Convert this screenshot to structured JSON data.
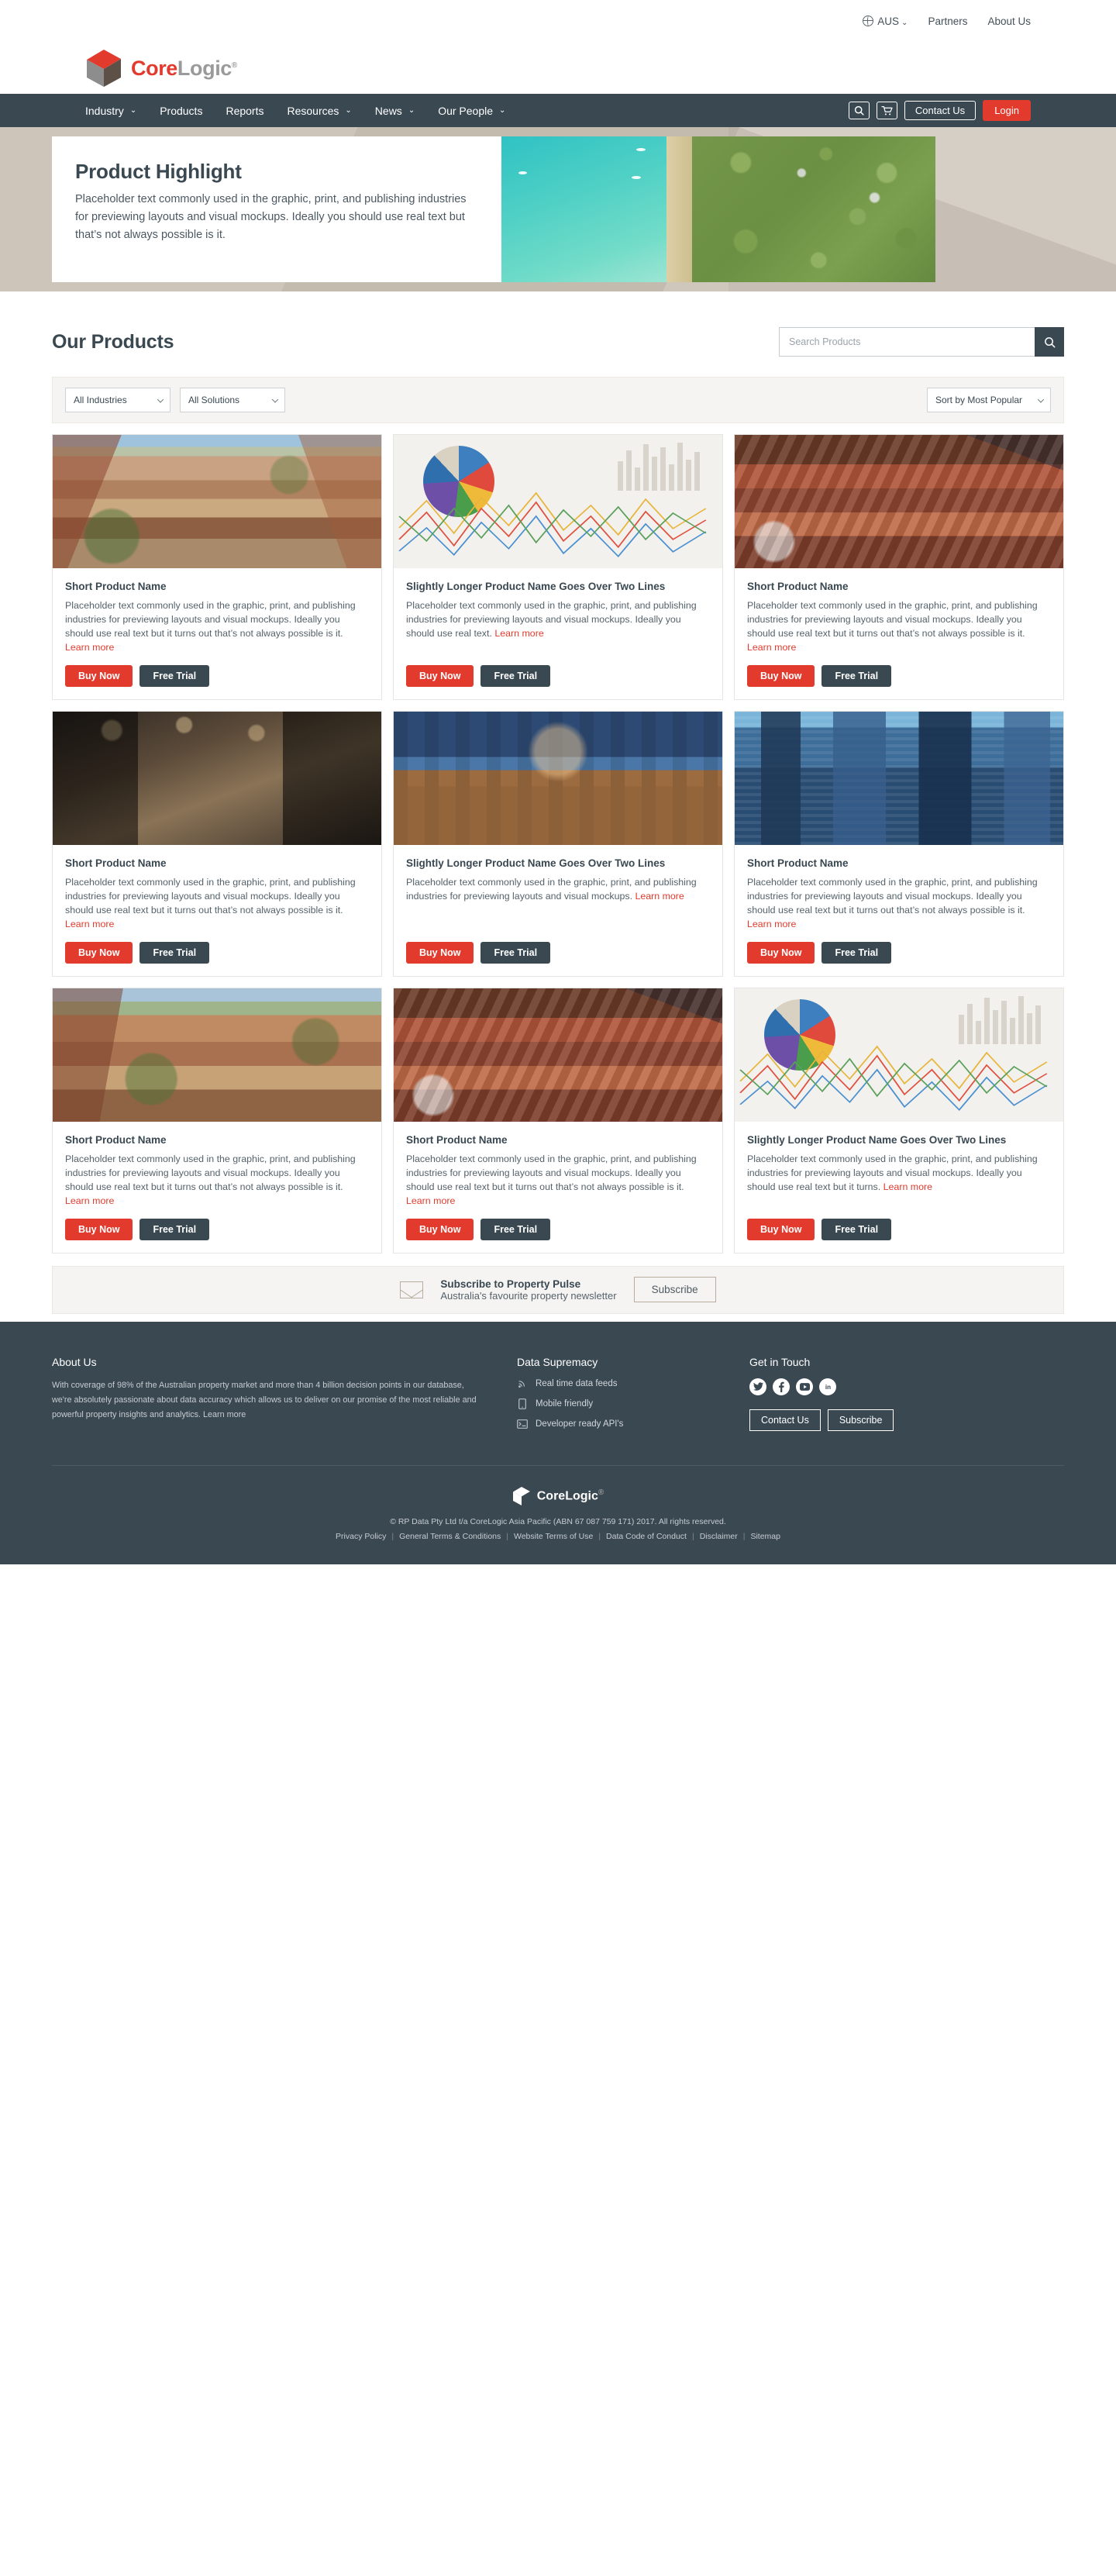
{
  "brand": {
    "core": "Core",
    "logic": "Logic",
    "reg": "®",
    "accent_red": "#e23b2e",
    "dark": "#3a4852"
  },
  "utility": {
    "region_label": "AUS",
    "region_icon": "globe-icon",
    "links": [
      "Partners",
      "About Us"
    ]
  },
  "nav": {
    "items": [
      {
        "label": "Industry",
        "has_dropdown": true
      },
      {
        "label": "Products",
        "has_dropdown": false
      },
      {
        "label": "Reports",
        "has_dropdown": false
      },
      {
        "label": "Resources",
        "has_dropdown": true
      },
      {
        "label": "News",
        "has_dropdown": true
      },
      {
        "label": "Our People",
        "has_dropdown": true
      }
    ],
    "search_icon": "search-icon",
    "cart_icon": "shopping-cart-icon",
    "contact_label": "Contact Us",
    "login_label": "Login"
  },
  "hero": {
    "title": "Product Highlight",
    "text": "Placeholder text commonly used in the graphic, print, and publishing industries for previewing layouts and visual mockups. Ideally you should use real text but that’s not always possible is it.",
    "image_alt": "aerial-coastline-photo"
  },
  "products_section": {
    "title": "Our Products",
    "search_placeholder": "Search Products",
    "search_value": "",
    "search_button_icon": "search-icon",
    "filters": [
      {
        "name": "industry-filter",
        "value": "All Industries"
      },
      {
        "name": "solutions-filter",
        "value": "All Solutions"
      }
    ],
    "sort": {
      "name": "sort-filter",
      "value": "Sort by Most Popular"
    },
    "buy_label": "Buy Now",
    "trial_label": "Free Trial",
    "learn_more_label": "Learn more",
    "cards": [
      {
        "name": "Short Product Name",
        "desc": "Placeholder text commonly used in the graphic, print, and publishing industries for previewing layouts and visual mockups. Ideally you should use real text but it turns out that’s not always possible is it. ",
        "art": "art-suburb1"
      },
      {
        "name": "Slightly Longer Product Name Goes Over Two Lines",
        "desc": "Placeholder text commonly used in the graphic, print, and publishing industries for previewing layouts and visual mockups. Ideally you should use real text. ",
        "art": "art-chart"
      },
      {
        "name": "Short Product Name",
        "desc": "Placeholder text commonly used in the graphic, print, and publishing industries for previewing layouts and visual mockups. Ideally you should use real text but it turns out that’s not always possible is it. ",
        "art": "art-roofs"
      },
      {
        "name": "Short Product Name",
        "desc": "Placeholder text commonly used in the graphic, print, and publishing industries for previewing layouts and visual mockups. Ideally you should use real text but it turns out that’s not always possible is it. ",
        "art": "art-lobby"
      },
      {
        "name": "Slightly Longer Product Name Goes Over Two Lines",
        "desc": "Placeholder text commonly used in the graphic, print, and publishing industries for previewing layouts and visual mockups. ",
        "art": "art-terrace"
      },
      {
        "name": "Short Product Name",
        "desc": "Placeholder text commonly used in the graphic, print, and publishing industries for previewing layouts and visual mockups. Ideally you should use real text but it turns out that’s not always possible is it. ",
        "art": "art-city"
      },
      {
        "name": "Short Product Name",
        "desc": "Placeholder text commonly used in the graphic, print, and publishing industries for previewing layouts and visual mockups. Ideally you should use real text but it turns out that’s not always possible is it. ",
        "art": "art-aerial"
      },
      {
        "name": "Short Product Name",
        "desc": "Placeholder text commonly used in the graphic, print, and publishing industries for previewing layouts and visual mockups. Ideally you should use real text but it turns out that’s not always possible is it. ",
        "art": "art-roofs"
      },
      {
        "name": "Slightly Longer Product Name Goes Over Two Lines",
        "desc": "Placeholder text commonly used in the graphic, print, and publishing industries for previewing layouts and visual mockups. Ideally you should use real text but it turns. ",
        "art": "art-chart"
      }
    ]
  },
  "subscribe_strip": {
    "icon": "envelope-icon",
    "title": "Subscribe to Property Pulse",
    "subtitle": "Australia's favourite property newsletter",
    "button_label": "Subscribe"
  },
  "footer": {
    "about": {
      "heading": "About Us",
      "text": "With coverage of 98% of the Australian property market and more than 4 billion decision points in our database, we're absolutely passionate about data accuracy which allows us to deliver on our promise of the most reliable and powerful property insights and analytics. ",
      "learn_more": "Learn more"
    },
    "data_supremacy": {
      "heading": "Data Supremacy",
      "items": [
        {
          "icon": "rss-icon",
          "label": "Real time data feeds"
        },
        {
          "icon": "mobile-icon",
          "label": "Mobile friendly"
        },
        {
          "icon": "terminal-icon",
          "label": "Developer ready API's"
        }
      ]
    },
    "get_in_touch": {
      "heading": "Get in Touch",
      "socials": [
        {
          "icon": "twitter-icon",
          "glyph": "t"
        },
        {
          "icon": "facebook-icon",
          "glyph": "f"
        },
        {
          "icon": "youtube-icon",
          "glyph": "▶"
        },
        {
          "icon": "linkedin-icon",
          "glyph": "in"
        }
      ],
      "buttons": [
        "Contact Us",
        "Subscribe"
      ]
    },
    "copyright": "© RP Data Pty Ltd t/a CoreLogic Asia Pacific (ABN 67 087 759 171) 2017. All rights reserved.",
    "legal_links": [
      "Privacy Policy",
      "General Terms & Conditions",
      "Website Terms of Use",
      "Data Code of Conduct",
      "Disclaimer",
      "Sitemap"
    ]
  }
}
